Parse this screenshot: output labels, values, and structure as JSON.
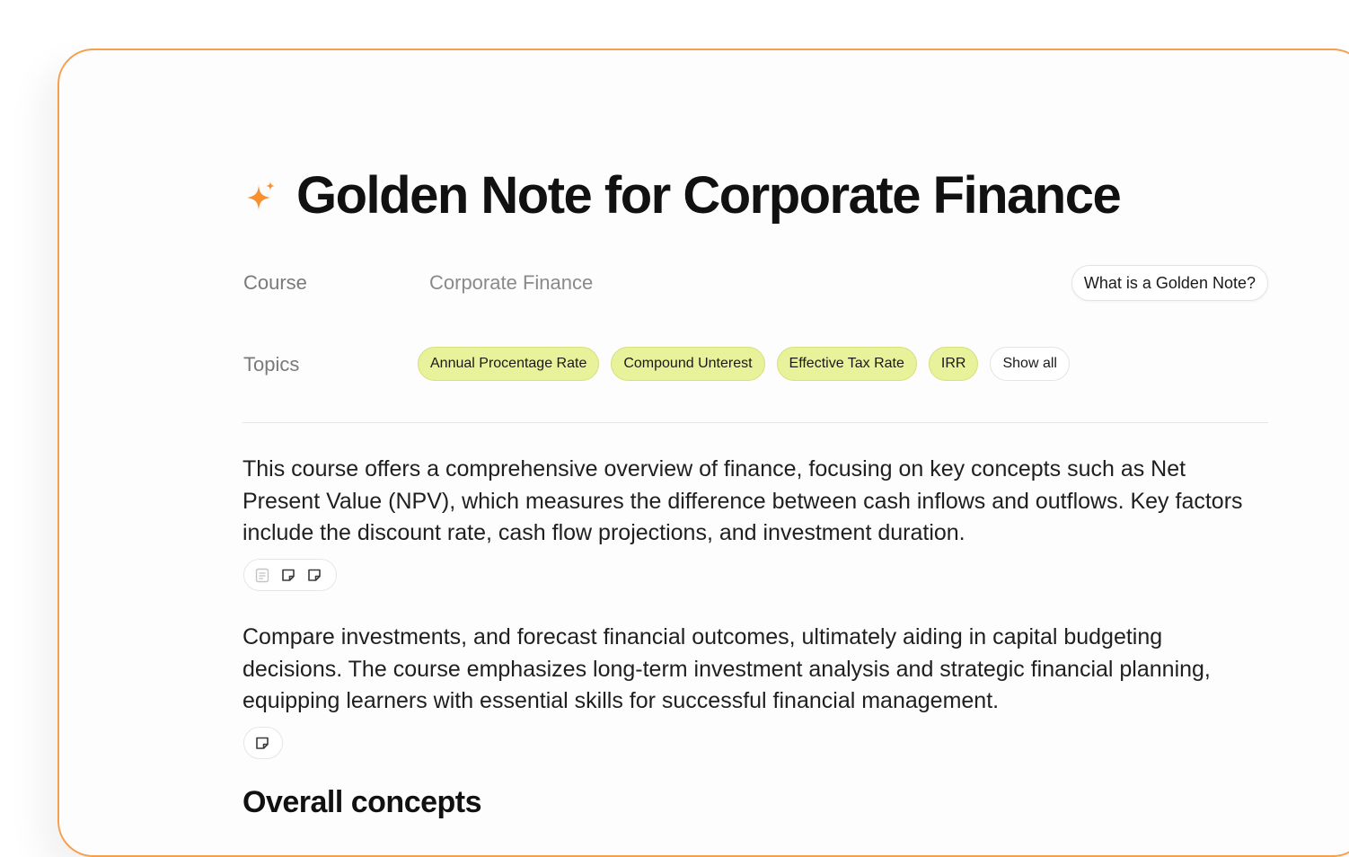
{
  "header": {
    "icon": "sparkle-icon",
    "title": "Golden Note for Corporate Finance"
  },
  "meta": {
    "course_label": "Course",
    "course_value": "Corporate Finance",
    "topics_label": "Topics",
    "help_button": "What is a Golden Note?"
  },
  "topics": [
    "Annual Procentage Rate",
    "Compound Unterest",
    "Effective Tax Rate",
    "IRR"
  ],
  "show_all_label": "Show all",
  "paragraphs": [
    "This course offers a comprehensive overview of finance, focusing on key concepts such as Net Present Value (NPV), which measures the difference between cash inflows and outflows. Key factors include the discount rate, cash flow projections, and investment duration.",
    "Compare investments, and forecast financial outcomes, ultimately aiding in capital budgeting decisions. The course emphasizes long-term investment analysis and strategic financial planning, equipping learners with essential skills for successful financial management."
  ],
  "source_icons": {
    "paragraph_1": [
      "document-icon",
      "note-icon",
      "note-icon"
    ],
    "paragraph_2": [
      "note-icon"
    ]
  },
  "section_heading": "Overall concepts",
  "colors": {
    "accent_border": "#f5a04a",
    "sparkle": "#f7902f",
    "chip_background": "#e7f29a"
  }
}
